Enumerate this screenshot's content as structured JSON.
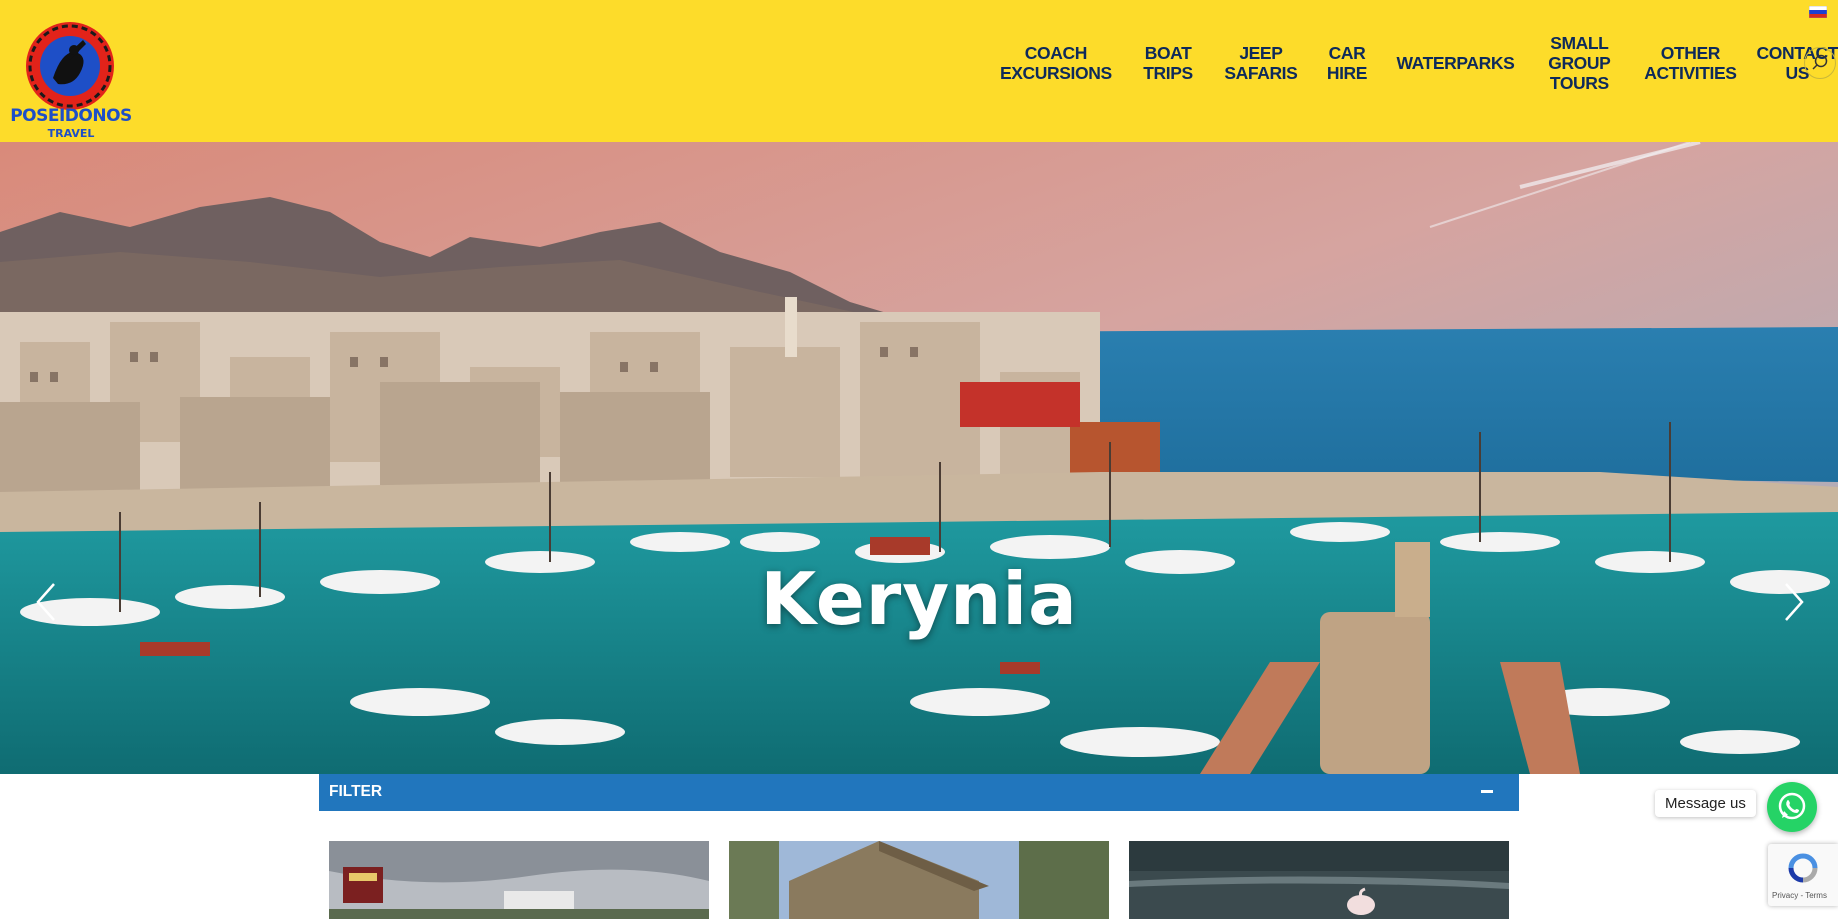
{
  "brand": {
    "name": "POSEIDONOS",
    "sub": "TRAVEL"
  },
  "language_flag": "russian-flag-icon",
  "nav": [
    {
      "label": "COACH\nEXCURSIONS"
    },
    {
      "label": "BOAT TRIPS"
    },
    {
      "label": "JEEP\nSAFARIS"
    },
    {
      "label": "CAR HIRE"
    },
    {
      "label": "WATERPARKS"
    },
    {
      "label": "SMALL\nGROUP TOURS"
    },
    {
      "label": "OTHER\nACTIVITIES"
    },
    {
      "label": "CONTACT US"
    }
  ],
  "search_icon": "search-icon",
  "hero": {
    "title": "Kerynia",
    "prev_icon": "chevron-left-icon",
    "next_icon": "chevron-right-icon"
  },
  "filter": {
    "label": "FILTER",
    "toggle_icon": "minus-icon"
  },
  "chat": {
    "label": "Message us",
    "icon": "whatsapp-icon"
  },
  "recaptcha": {
    "text": "Privacy - Terms"
  },
  "colors": {
    "header": "#fddc2a",
    "nav_text": "#0e2a5a",
    "filter_bar": "#2176bd",
    "whatsapp": "#25d366"
  }
}
